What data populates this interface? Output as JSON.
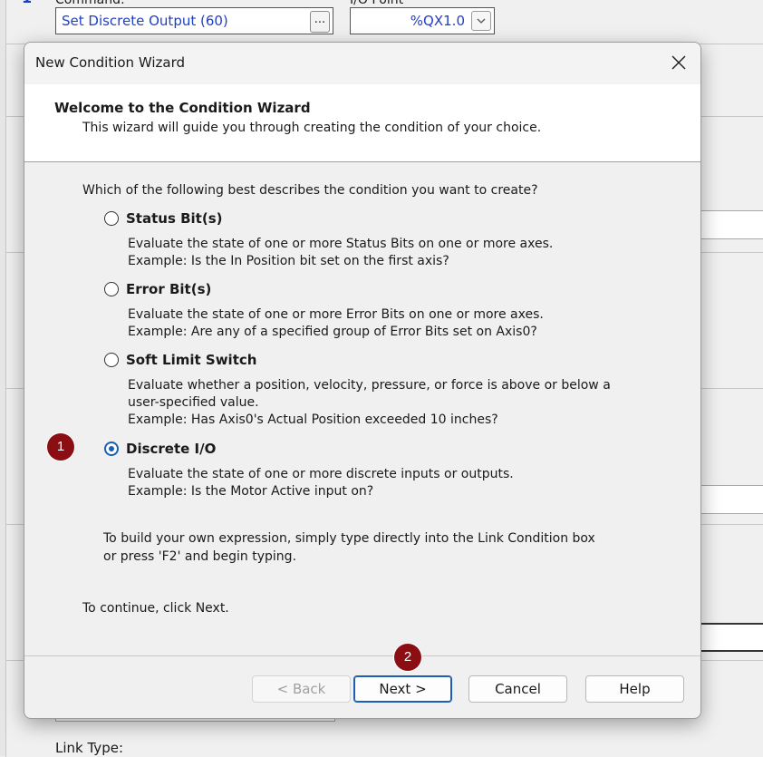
{
  "background": {
    "command_label_clip": "Command:",
    "io_label_clip": "I/O Point",
    "command_value": "Set Discrete Output (60)",
    "command_browse_label": "...",
    "io_value": "%QX1.0",
    "link_type_label": "Link Type:"
  },
  "dialog": {
    "title": "New Condition Wizard",
    "header_title": "Welcome to the Condition Wizard",
    "header_subtitle": "This wizard will guide you through creating the condition of your choice.",
    "question": "Which of the following best describes the condition you want to create?",
    "options": [
      {
        "label": "Status Bit(s)",
        "selected": false,
        "desc": [
          "Evaluate the state of one or more Status Bits on one or more axes.",
          "Example: Is the In Position bit set on the first axis?"
        ]
      },
      {
        "label": "Error Bit(s)",
        "selected": false,
        "desc": [
          "Evaluate the state of one or more Error Bits on one or more axes.",
          "Example: Are any of a specified group of Error Bits set on Axis0?"
        ]
      },
      {
        "label": "Soft Limit Switch",
        "selected": false,
        "desc": [
          "Evaluate whether a position, velocity, pressure, or force is above or below a",
          "user-specified value.",
          "Example: Has Axis0's Actual Position exceeded 10 inches?"
        ]
      },
      {
        "label": "Discrete I/O",
        "selected": true,
        "desc": [
          "Evaluate the state of one or more discrete inputs or outputs.",
          "Example: Is the Motor Active input on?"
        ]
      }
    ],
    "tip": [
      "To build your own expression, simply type directly into the Link Condition box",
      "or press 'F2' and begin typing."
    ],
    "continue_text": "To continue, click Next.",
    "buttons": {
      "back": "< Back",
      "next": "Next >",
      "cancel": "Cancel",
      "help": "Help"
    }
  },
  "annotations": {
    "marker1": "1",
    "marker2": "2",
    "color": "#8b0f12"
  },
  "colors": {
    "accent": "#1a5fb4",
    "field_text": "#2040c8"
  }
}
